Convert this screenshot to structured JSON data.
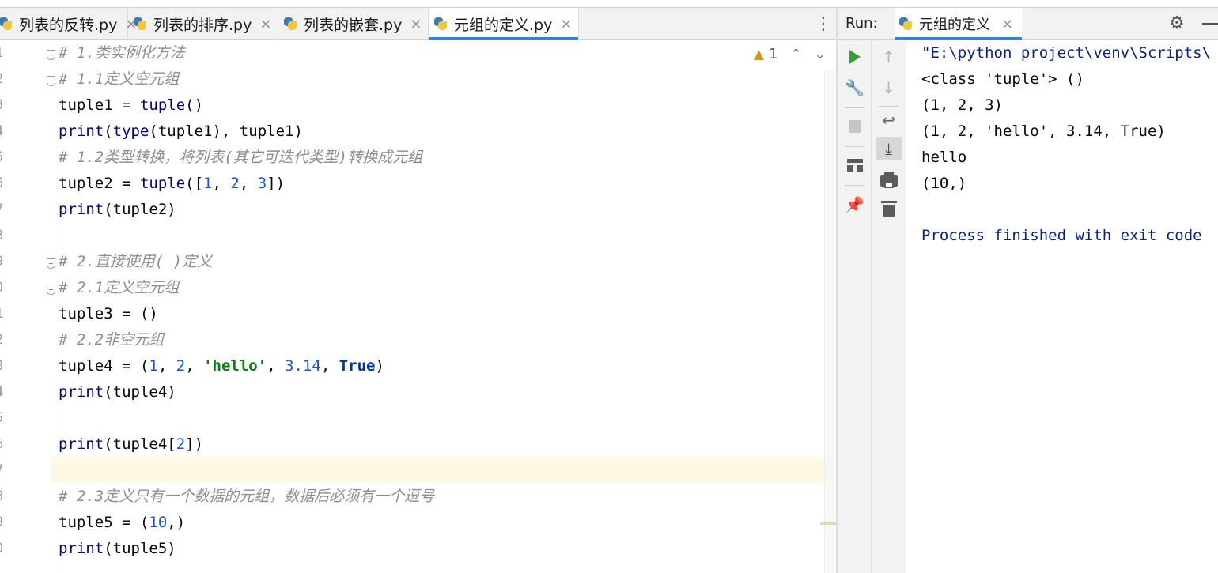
{
  "editor": {
    "tabs": [
      {
        "label": "列表的反转.py",
        "active": false
      },
      {
        "label": "列表的排序.py",
        "active": false
      },
      {
        "label": "列表的嵌套.py",
        "active": false
      },
      {
        "label": "元组的定义.py",
        "active": true
      }
    ],
    "tab_close_glyph": "×",
    "tab_menu_glyph": "⋮",
    "inspection": {
      "warning_count": "1",
      "up_glyph": "⌃",
      "down_glyph": "⌄"
    },
    "line_numbers": [
      "1",
      "2",
      "3",
      "4",
      "5",
      "6",
      "7",
      "8",
      "9",
      "0",
      "1",
      "2",
      "3",
      "4",
      "5",
      "6",
      "7",
      "8",
      "9",
      "0"
    ],
    "current_line_index": 16
  },
  "code": [
    [
      {
        "t": "# 1.类实例化方法",
        "c": "cm"
      }
    ],
    [
      {
        "t": "# 1.1定义空元组",
        "c": "cm"
      }
    ],
    [
      {
        "t": "tuple1 = ",
        "c": ""
      },
      {
        "t": "tuple",
        "c": "fn"
      },
      {
        "t": "()",
        "c": ""
      }
    ],
    [
      {
        "t": "print",
        "c": "fn"
      },
      {
        "t": "(",
        "c": ""
      },
      {
        "t": "type",
        "c": "fn"
      },
      {
        "t": "(tuple1), tuple1)",
        "c": ""
      }
    ],
    [
      {
        "t": "# 1.2类型转换，将列表(其它可迭代类型)转换成元组",
        "c": "cm"
      }
    ],
    [
      {
        "t": "tuple2 = ",
        "c": ""
      },
      {
        "t": "tuple",
        "c": "fn"
      },
      {
        "t": "([",
        "c": ""
      },
      {
        "t": "1",
        "c": "num"
      },
      {
        "t": ", ",
        "c": ""
      },
      {
        "t": "2",
        "c": "num"
      },
      {
        "t": ", ",
        "c": ""
      },
      {
        "t": "3",
        "c": "num"
      },
      {
        "t": "])",
        "c": ""
      }
    ],
    [
      {
        "t": "print",
        "c": "fn"
      },
      {
        "t": "(tuple2)",
        "c": ""
      }
    ],
    [],
    [
      {
        "t": "# 2.直接使用( )定义",
        "c": "cm"
      }
    ],
    [
      {
        "t": "# 2.1定义空元组",
        "c": "cm"
      }
    ],
    [
      {
        "t": "tuple3 = ()",
        "c": ""
      }
    ],
    [
      {
        "t": "# 2.2非空元组",
        "c": "cm"
      }
    ],
    [
      {
        "t": "tuple4 = (",
        "c": ""
      },
      {
        "t": "1",
        "c": "num"
      },
      {
        "t": ", ",
        "c": ""
      },
      {
        "t": "2",
        "c": "num"
      },
      {
        "t": ", ",
        "c": ""
      },
      {
        "t": "'hello'",
        "c": "str"
      },
      {
        "t": ", ",
        "c": ""
      },
      {
        "t": "3.14",
        "c": "num"
      },
      {
        "t": ", ",
        "c": ""
      },
      {
        "t": "True",
        "c": "kw"
      },
      {
        "t": ")",
        "c": ""
      }
    ],
    [
      {
        "t": "print",
        "c": "fn"
      },
      {
        "t": "(tuple4)",
        "c": ""
      }
    ],
    [],
    [
      {
        "t": "print",
        "c": "fn"
      },
      {
        "t": "(tuple4[",
        "c": ""
      },
      {
        "t": "2",
        "c": "num"
      },
      {
        "t": "])",
        "c": ""
      }
    ],
    [],
    [
      {
        "t": "# 2.3定义只有一个数据的元组，数据后必须有一个逗号",
        "c": "cm"
      }
    ],
    [
      {
        "t": "tuple5 = (",
        "c": ""
      },
      {
        "t": "10",
        "c": "num"
      },
      {
        "t": ",)",
        "c": ""
      }
    ],
    [
      {
        "t": "print",
        "c": "fn"
      },
      {
        "t": "(tuple5)",
        "c": ""
      }
    ]
  ],
  "run": {
    "label": "Run:",
    "tab_label": "元组的定义",
    "close_glyph": "×",
    "toolbar1": [
      "run-icon",
      "wrench-icon",
      "stop-icon",
      "layout-icon",
      "pin-icon"
    ],
    "toolbar2": [
      "arrow-up-icon",
      "arrow-down-icon",
      "soft-wrap-icon",
      "scroll-to-end-icon",
      "print-icon",
      "trash-icon"
    ],
    "console": [
      {
        "text": "\"E:\\python project\\venv\\Scripts\\",
        "cls": "path"
      },
      {
        "text": "<class 'tuple'> ()",
        "cls": ""
      },
      {
        "text": "(1, 2, 3)",
        "cls": ""
      },
      {
        "text": "(1, 2, 'hello', 3.14, True)",
        "cls": ""
      },
      {
        "text": "hello",
        "cls": ""
      },
      {
        "text": "(10,)",
        "cls": ""
      },
      {
        "text": "",
        "cls": ""
      },
      {
        "text": "Process finished with exit code",
        "cls": "proc"
      }
    ]
  },
  "colors": {
    "accent": "#3d7edb",
    "comment": "#8c8c8c",
    "builtin": "#000080",
    "number": "#1750eb",
    "string": "#067d17",
    "keyword": "#0033b3",
    "current_line": "#fdf9e5",
    "run_green": "#3a9a3a"
  }
}
